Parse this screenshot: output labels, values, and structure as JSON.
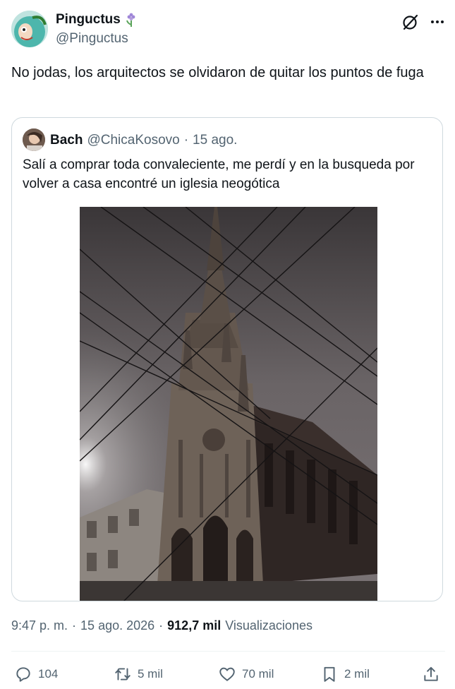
{
  "author": {
    "name": "Pinguctus",
    "handle": "@Pinguctus",
    "name_emoji_icon": "hyacinth-flower-icon"
  },
  "tweet": {
    "text": "No jodas, los arquitectos se olvidaron de quitar los puntos de fuga"
  },
  "quote": {
    "name": "Bach",
    "handle": "@ChicaKosovo",
    "separator": "·",
    "date": "15 ago.",
    "text": "Salí a comprar toda convaleciente, me perdí y en la busqueda por volver a casa encontré un iglesia neogótica"
  },
  "meta": {
    "time": "9:47 p. m.",
    "separator1": "·",
    "date": "15 ago. 2026",
    "separator2": "·",
    "views_count": "912,7 mil",
    "views_label": "Visualizaciones"
  },
  "actions": {
    "reply_count": "104",
    "retweet_count": "5 mil",
    "like_count": "70 mil",
    "bookmark_count": "2 mil"
  },
  "colors": {
    "text_primary": "#0f1419",
    "text_secondary": "#536471",
    "border": "#cfd9de"
  }
}
